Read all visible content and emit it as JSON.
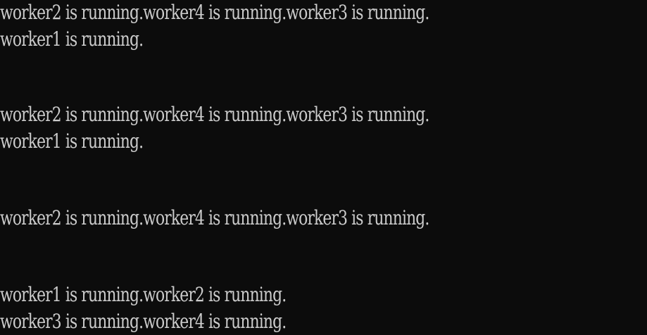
{
  "console": {
    "lines": [
      "worker2 is running.worker4 is running.worker3 is running.",
      "worker1 is running.",
      "",
      "",
      "worker2 is running.worker4 is running.worker3 is running.",
      "worker1 is running.",
      "",
      "",
      "worker2 is running.worker4 is running.worker3 is running.",
      "",
      "",
      "worker1 is running.worker2 is running.",
      "worker3 is running.worker4 is running."
    ]
  }
}
